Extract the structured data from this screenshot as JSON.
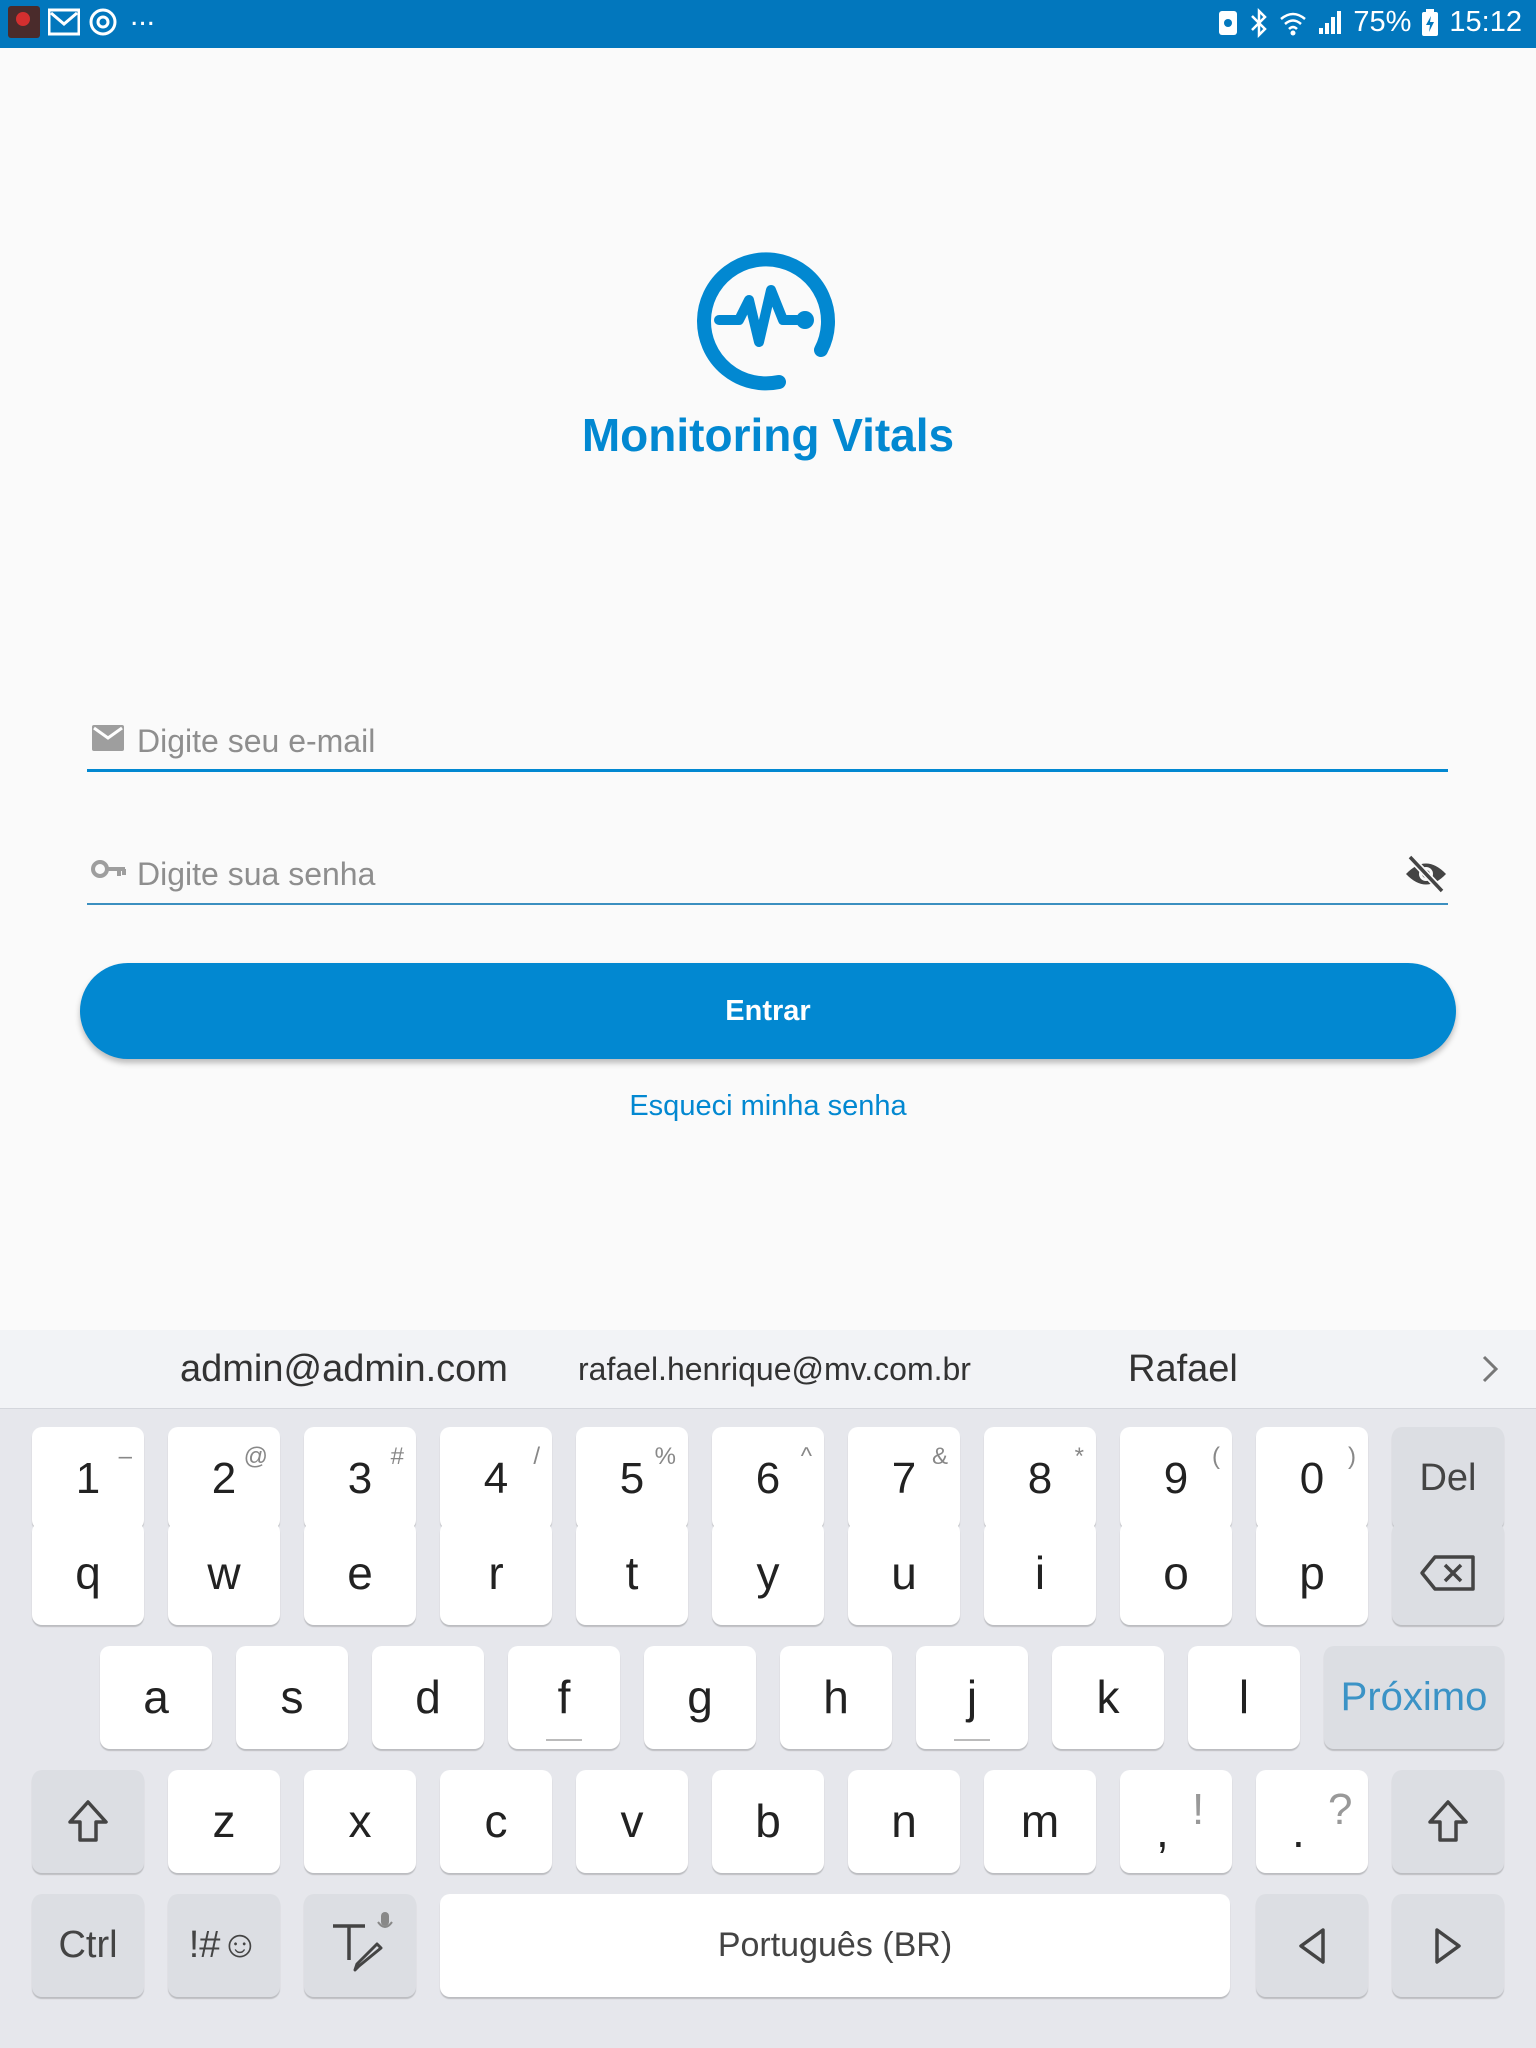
{
  "status_bar": {
    "battery": "75%",
    "time": "15:12",
    "overflow": "..."
  },
  "app": {
    "title": "Monitoring Vitals",
    "brand_color": "#0288d1"
  },
  "login": {
    "email_placeholder": "Digite seu e-mail",
    "password_placeholder": "Digite sua senha",
    "submit_label": "Entrar",
    "forgot_label": "Esqueci minha senha"
  },
  "keyboard": {
    "suggestions": [
      "admin@admin.com",
      "rafael.henrique@mv.com.br",
      "Rafael"
    ],
    "number_row": [
      {
        "main": "1",
        "sup": "–"
      },
      {
        "main": "2",
        "sup": "@"
      },
      {
        "main": "3",
        "sup": "#"
      },
      {
        "main": "4",
        "sup": "/"
      },
      {
        "main": "5",
        "sup": "%"
      },
      {
        "main": "6",
        "sup": "^"
      },
      {
        "main": "7",
        "sup": "&"
      },
      {
        "main": "8",
        "sup": "*"
      },
      {
        "main": "9",
        "sup": "("
      },
      {
        "main": "0",
        "sup": ")"
      }
    ],
    "del_label": "Del",
    "row1": [
      "q",
      "w",
      "e",
      "r",
      "t",
      "y",
      "u",
      "i",
      "o",
      "p"
    ],
    "row2": [
      "a",
      "s",
      "d",
      "f",
      "g",
      "h",
      "j",
      "k",
      "l"
    ],
    "next_label": "Próximo",
    "row3": [
      "z",
      "x",
      "c",
      "v",
      "b",
      "n",
      "m"
    ],
    "comma": {
      "main": ",",
      "alt": "!"
    },
    "period": {
      "main": ".",
      "alt": "?"
    },
    "ctrl_label": "Ctrl",
    "symbols_label": "!#☺",
    "space_label": "Português (BR)"
  }
}
